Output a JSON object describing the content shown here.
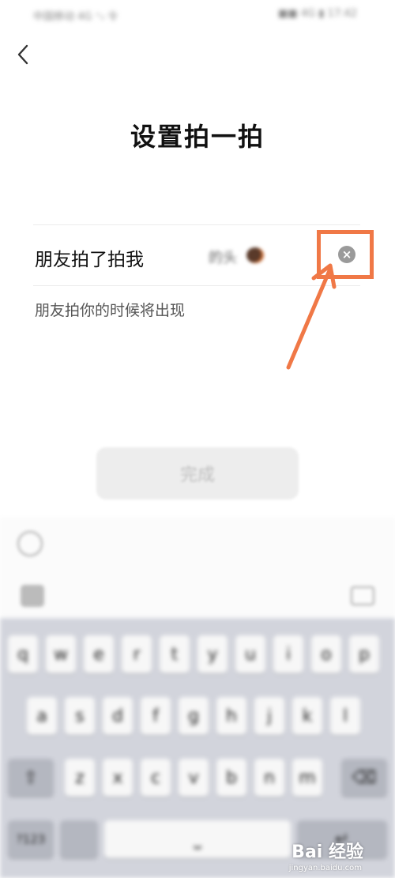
{
  "status_bar": {
    "left": "中国移动 4G ⁺ᵢₗ 令",
    "right": "■■ 4G ▮ 17:42"
  },
  "page": {
    "title": "设置拍一拍"
  },
  "field": {
    "label": "朋友拍了拍我",
    "suffix": "的头",
    "clear_icon": "×",
    "hint": "朋友拍你的时候将出现"
  },
  "actions": {
    "done_label": "完成"
  },
  "keyboard": {
    "row1": [
      "q",
      "w",
      "e",
      "r",
      "t",
      "y",
      "u",
      "i",
      "o",
      "p"
    ],
    "row2": [
      "a",
      "s",
      "d",
      "f",
      "g",
      "h",
      "j",
      "k",
      "l"
    ],
    "row3": [
      "z",
      "x",
      "c",
      "v",
      "b",
      "n",
      "m"
    ],
    "shift_icon": "⇧",
    "delete_icon": "⌫",
    "bottom_left": "?123",
    "bottom_space": "⎵",
    "return_label": "↵"
  },
  "watermark": {
    "brand": "Bai 经验",
    "url": "jingyan.baidu.com"
  },
  "colors": {
    "annotation": "#f07846",
    "keyboard_bg": "#d2d4dc"
  }
}
